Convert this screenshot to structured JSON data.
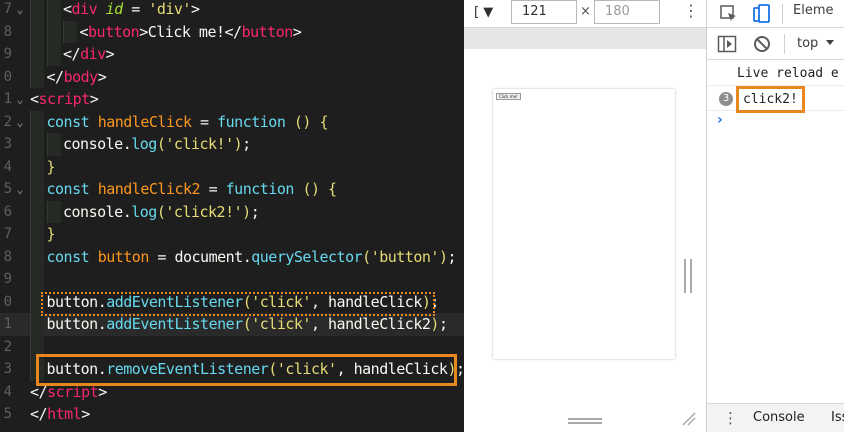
{
  "editor": {
    "lines": [
      {
        "num": "7",
        "fold": "⌄",
        "tokens": [
          [
            "punc",
            "<"
          ],
          [
            "tag",
            "div"
          ],
          [
            "plain",
            " "
          ],
          [
            "attr",
            "id"
          ],
          [
            "plain",
            " = "
          ],
          [
            "str",
            "'div'"
          ],
          [
            "punc",
            ">"
          ]
        ]
      },
      {
        "num": "8",
        "fold": "",
        "tokens": [
          [
            "punc",
            "<"
          ],
          [
            "tag",
            "button"
          ],
          [
            "punc",
            ">"
          ],
          [
            "text",
            "Click me!"
          ],
          [
            "punc",
            "</"
          ],
          [
            "tag",
            "button"
          ],
          [
            "punc",
            ">"
          ]
        ]
      },
      {
        "num": "9",
        "fold": "",
        "tokens": [
          [
            "punc",
            "</"
          ],
          [
            "tag",
            "div"
          ],
          [
            "punc",
            ">"
          ]
        ]
      },
      {
        "num": "0",
        "fold": "",
        "tokens": [
          [
            "punc",
            "</"
          ],
          [
            "tag",
            "body"
          ],
          [
            "punc",
            ">"
          ]
        ]
      },
      {
        "num": "1",
        "fold": "⌄",
        "tokens": [
          [
            "punc",
            "<"
          ],
          [
            "tag",
            "script"
          ],
          [
            "punc",
            ">"
          ]
        ]
      },
      {
        "num": "2",
        "fold": "⌄",
        "tokens": [
          [
            "kw",
            "const"
          ],
          [
            "plain",
            " "
          ],
          [
            "var",
            "handleClick"
          ],
          [
            "plain",
            " = "
          ],
          [
            "kw",
            "function"
          ],
          [
            "plain",
            " "
          ],
          [
            "yellow",
            "() {"
          ]
        ]
      },
      {
        "num": "3",
        "fold": "",
        "tokens": [
          [
            "plain",
            "console"
          ],
          [
            "punc",
            "."
          ],
          [
            "fn",
            "log"
          ],
          [
            "yellow",
            "("
          ],
          [
            "str",
            "'click!'"
          ],
          [
            "yellow",
            ")"
          ],
          [
            "plain",
            ";"
          ]
        ]
      },
      {
        "num": "4",
        "fold": "",
        "tokens": [
          [
            "yellow",
            "}"
          ]
        ]
      },
      {
        "num": "5",
        "fold": "⌄",
        "tokens": [
          [
            "kw",
            "const"
          ],
          [
            "plain",
            " "
          ],
          [
            "var",
            "handleClick2"
          ],
          [
            "plain",
            " = "
          ],
          [
            "kw",
            "function"
          ],
          [
            "plain",
            " "
          ],
          [
            "yellow",
            "() {"
          ]
        ]
      },
      {
        "num": "6",
        "fold": "",
        "tokens": [
          [
            "plain",
            "console"
          ],
          [
            "punc",
            "."
          ],
          [
            "fn",
            "log"
          ],
          [
            "yellow",
            "("
          ],
          [
            "str",
            "'click2!'"
          ],
          [
            "yellow",
            ")"
          ],
          [
            "plain",
            ";"
          ]
        ]
      },
      {
        "num": "7",
        "fold": "",
        "tokens": [
          [
            "yellow",
            "}"
          ]
        ]
      },
      {
        "num": "8",
        "fold": "",
        "tokens": [
          [
            "kw",
            "const"
          ],
          [
            "plain",
            " "
          ],
          [
            "var",
            "button"
          ],
          [
            "plain",
            " = "
          ],
          [
            "plain",
            "document"
          ],
          [
            "punc",
            "."
          ],
          [
            "fn",
            "querySelector"
          ],
          [
            "yellow",
            "("
          ],
          [
            "str",
            "'button'"
          ],
          [
            "yellow",
            ")"
          ],
          [
            "plain",
            ";"
          ]
        ]
      },
      {
        "num": "9",
        "fold": "",
        "tokens": []
      },
      {
        "num": "0",
        "fold": "",
        "tokens": [
          [
            "plain",
            "button"
          ],
          [
            "punc",
            "."
          ],
          [
            "fn",
            "addEventListener"
          ],
          [
            "yellow",
            "("
          ],
          [
            "str",
            "'click'"
          ],
          [
            "plain",
            ", handleClick"
          ],
          [
            "yellow",
            ")"
          ],
          [
            "plain",
            ";"
          ]
        ]
      },
      {
        "num": "1",
        "fold": "",
        "tokens": [
          [
            "plain",
            "button"
          ],
          [
            "punc",
            "."
          ],
          [
            "fn",
            "addEventListener"
          ],
          [
            "yellow",
            "("
          ],
          [
            "str",
            "'click'"
          ],
          [
            "plain",
            ", handleClick2"
          ],
          [
            "yellow",
            ")"
          ],
          [
            "plain",
            ";"
          ]
        ]
      },
      {
        "num": "2",
        "fold": "",
        "tokens": []
      },
      {
        "num": "3",
        "fold": "",
        "tokens": [
          [
            "plain",
            "button"
          ],
          [
            "punc",
            "."
          ],
          [
            "fn",
            "removeEventListener"
          ],
          [
            "yellow",
            "("
          ],
          [
            "str",
            "'click'"
          ],
          [
            "plain",
            ", handleClick"
          ],
          [
            "yellow",
            ")"
          ],
          [
            "plain",
            ";"
          ]
        ]
      },
      {
        "num": "4",
        "fold": "",
        "tokens": [
          [
            "punc",
            "</"
          ],
          [
            "tag",
            "script"
          ],
          [
            "punc",
            ">"
          ]
        ]
      },
      {
        "num": "5",
        "fold": "",
        "tokens": [
          [
            "punc",
            "</"
          ],
          [
            "tag",
            "html"
          ],
          [
            "punc",
            ">"
          ]
        ]
      }
    ],
    "active_line": 14,
    "indents": [
      2,
      3,
      2,
      1,
      0,
      1,
      2,
      1,
      1,
      2,
      1,
      1,
      1,
      1,
      1,
      1,
      1,
      0,
      0
    ]
  },
  "browser": {
    "device_select": "[ ▼",
    "width_value": "121",
    "height_placeholder": "180",
    "times": "×",
    "page_button_label": "Click me!"
  },
  "devtools": {
    "tab_elements": "Eleme",
    "context_select": "top",
    "log": [
      {
        "text": "Live reload e",
        "count": ""
      },
      {
        "text": "click2!",
        "count": "3"
      }
    ],
    "drawer_tabs": [
      "Console",
      "Iss"
    ]
  },
  "colors": {
    "highlight": "#e8871e",
    "editor_bg": "#1e1e1e"
  }
}
